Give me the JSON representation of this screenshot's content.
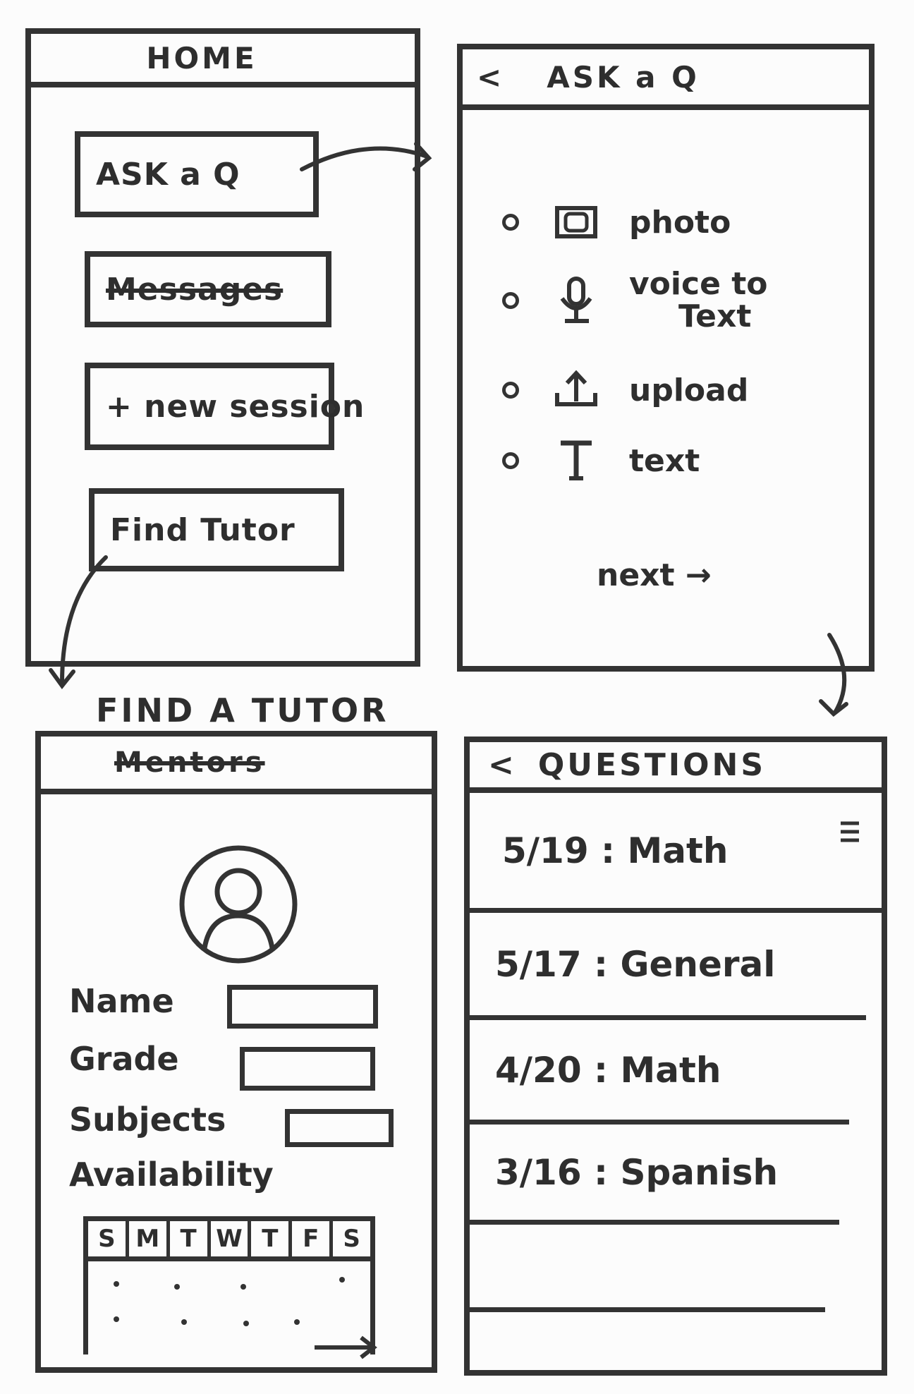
{
  "home": {
    "title": "HOME",
    "buttons": {
      "ask": "ASK a Q",
      "messages": "Messages",
      "new_session": "+ new session",
      "find_tutor": "Find Tutor"
    }
  },
  "ask": {
    "back": "<",
    "title": "ASK a Q",
    "options": [
      {
        "label": "photo",
        "icon": "camera-icon"
      },
      {
        "label": "voice to",
        "label2": "Text",
        "icon": "microphone-icon"
      },
      {
        "label": "upload",
        "icon": "upload-icon"
      },
      {
        "label": "text",
        "icon": "text-icon"
      }
    ],
    "next": "next →"
  },
  "find": {
    "caption": "FIND A TUTOR",
    "title": "Mentors",
    "fields": [
      "Name",
      "Grade",
      "Subjects"
    ],
    "availability": "Availability",
    "days": [
      "S",
      "M",
      "T",
      "W",
      "T",
      "F",
      "S"
    ]
  },
  "questions": {
    "back": "<",
    "title": "QUESTIONS",
    "menu_icon": "hamburger-menu-icon",
    "items": [
      "5/19 : Math",
      "5/17 : General",
      "4/20 : Math",
      "3/16 : Spanish"
    ]
  }
}
